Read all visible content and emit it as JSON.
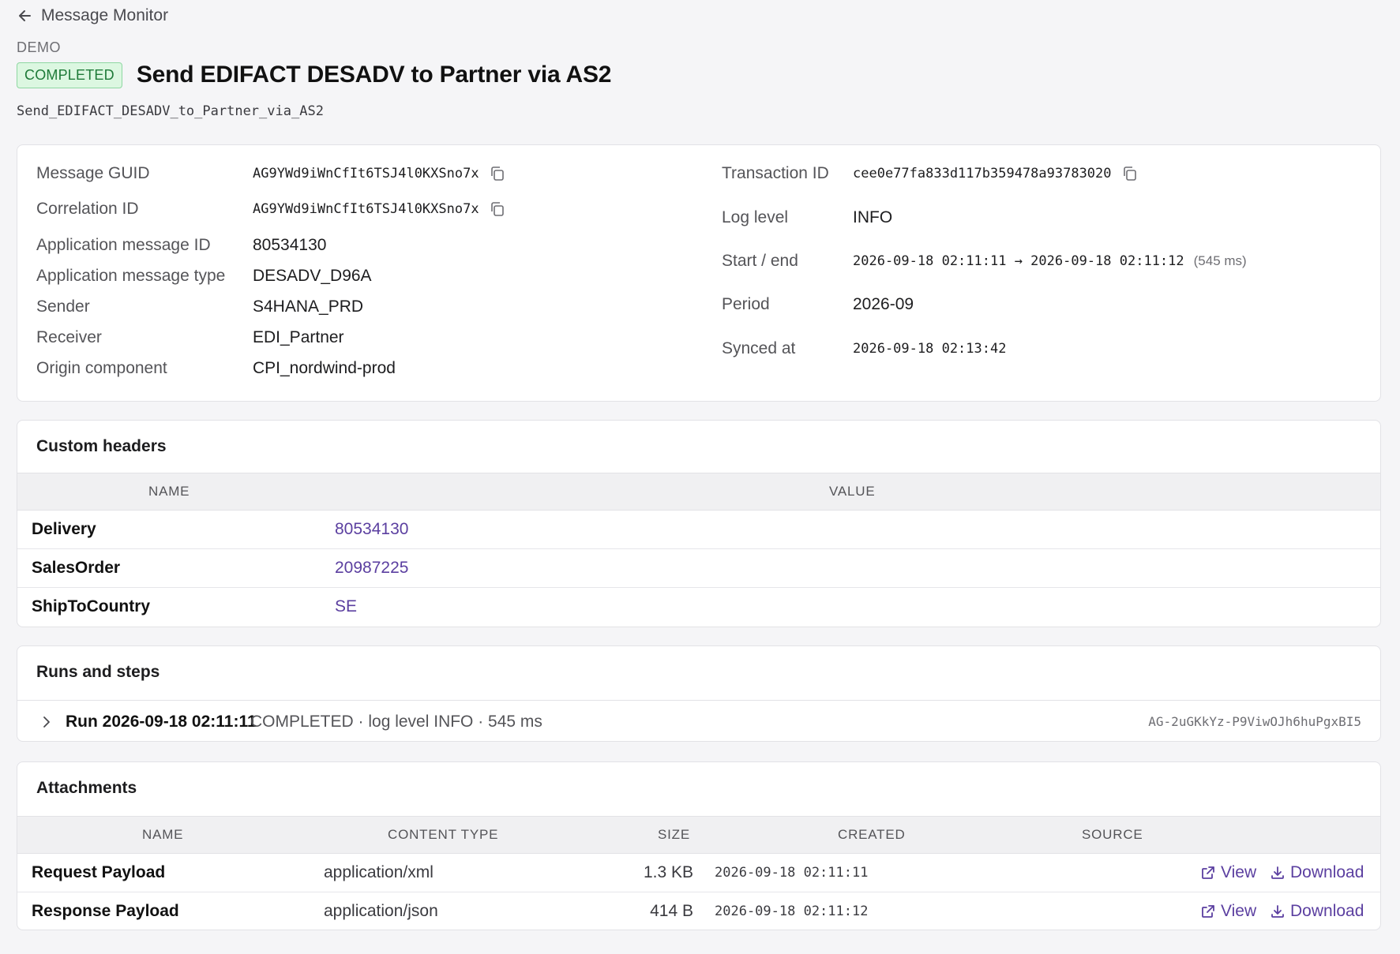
{
  "nav": {
    "back_label": "Message Monitor"
  },
  "env": "DEMO",
  "status": "COMPLETED",
  "title": "Send EDIFACT DESADV to Partner via AS2",
  "iflow_id": "Send_EDIFACT_DESADV_to_Partner_via_AS2",
  "overview": {
    "message_guid": {
      "label": "Message GUID",
      "value": "AG9YWd9iWnCfIt6TSJ4l0KXSno7x"
    },
    "correlation_id": {
      "label": "Correlation ID",
      "value": "AG9YWd9iWnCfIt6TSJ4l0KXSno7x"
    },
    "app_message_id": {
      "label": "Application message ID",
      "value": "80534130"
    },
    "app_message_type": {
      "label": "Application message type",
      "value": "DESADV_D96A"
    },
    "sender": {
      "label": "Sender",
      "value": "S4HANA_PRD"
    },
    "receiver": {
      "label": "Receiver",
      "value": "EDI_Partner"
    },
    "origin_component": {
      "label": "Origin component",
      "value": "CPI_nordwind-prod"
    },
    "transaction_id": {
      "label": "Transaction ID",
      "value": "cee0e77fa833d117b359478a93783020"
    },
    "log_level": {
      "label": "Log level",
      "value": "INFO"
    },
    "start_end": {
      "label": "Start / end",
      "value": "2026-09-18 02:11:11 → 2026-09-18 02:11:12",
      "duration": "(545 ms)"
    },
    "period": {
      "label": "Period",
      "value": "2026-09"
    },
    "synced_at": {
      "label": "Synced at",
      "value": "2026-09-18 02:13:42"
    }
  },
  "custom_headers": {
    "title": "Custom headers",
    "columns": [
      "NAME",
      "VALUE"
    ],
    "rows": [
      {
        "name": "Delivery",
        "value": "80534130"
      },
      {
        "name": "SalesOrder",
        "value": "20987225"
      },
      {
        "name": "ShipToCountry",
        "value": "SE"
      }
    ]
  },
  "runs": {
    "title": "Runs and steps",
    "items": [
      {
        "label": "Run 2026-09-18 02:11:11",
        "meta": "COMPLETED · log level INFO · 545 ms",
        "id": "AG-2uGKkYz-P9ViwOJh6huPgxBI5"
      }
    ]
  },
  "attachments": {
    "title": "Attachments",
    "columns": [
      "NAME",
      "CONTENT TYPE",
      "SIZE",
      "CREATED",
      "SOURCE"
    ],
    "rows": [
      {
        "name": "Request Payload",
        "content_type": "application/xml",
        "size": "1.3 KB",
        "created": "2026-09-18 02:11:11",
        "view": "View",
        "download": "Download"
      },
      {
        "name": "Response Payload",
        "content_type": "application/json",
        "size": "414 B",
        "created": "2026-09-18 02:11:12",
        "view": "View",
        "download": "Download"
      }
    ]
  },
  "colors": {
    "accent": "#5b3fa0",
    "badge_bg": "#dcf7e1",
    "badge_text": "#1e7a38"
  }
}
